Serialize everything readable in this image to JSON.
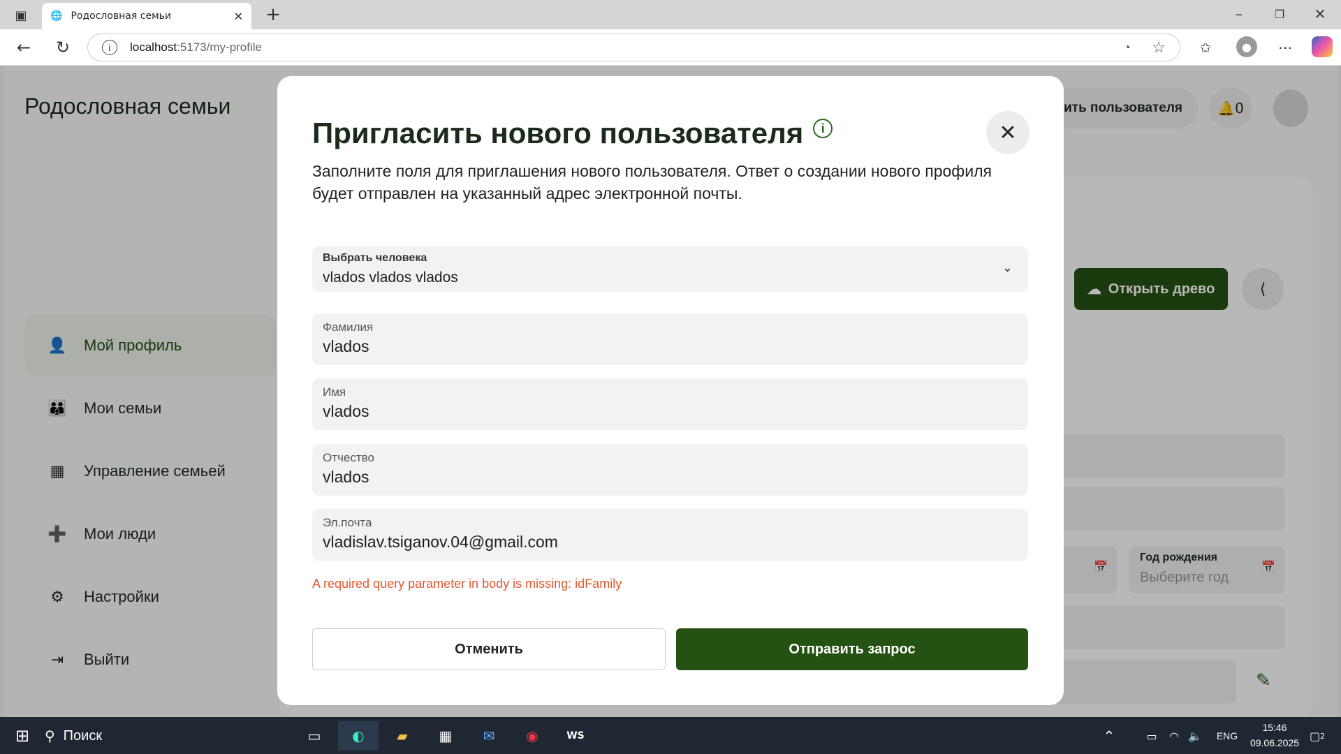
{
  "browser": {
    "tab_title": "Родословная семьи",
    "url_host": "localhost",
    "url_rest": ":5173/my-profile"
  },
  "app": {
    "title": "Родословная семьи",
    "header_invite_partial": "сить пользователя",
    "notif_count": "0",
    "open_tree": "Открыть древо",
    "birth_year_label": "Год рождения",
    "birth_year_placeholder": "Выберите год",
    "sidebar": [
      {
        "label": "Мой профиль"
      },
      {
        "label": "Мои семьи"
      },
      {
        "label": "Управление семьей"
      },
      {
        "label": "Мои люди"
      },
      {
        "label": "Настройки"
      },
      {
        "label": "Выйти"
      }
    ]
  },
  "modal": {
    "title": "Пригласить нового пользователя",
    "description": "Заполните поля для приглашения нового пользователя. Ответ о создании нового профиля будет отправлен на указанный адрес электронной почты.",
    "select_label": "Выбрать человека",
    "select_value": "vlados vlados vlados",
    "fields": [
      {
        "label": "Фамилия",
        "value": "vlados"
      },
      {
        "label": "Имя",
        "value": "vlados"
      },
      {
        "label": "Отчество",
        "value": "vlados"
      },
      {
        "label": "Эл.почта",
        "value": "vladislav.tsiganov.04@gmail.com"
      }
    ],
    "error": "A required query parameter in body is missing: idFamily",
    "cancel_label": "Отменить",
    "submit_label": "Отправить запрос"
  },
  "taskbar": {
    "search": "Поиск",
    "lang": "ENG",
    "time": "15:46",
    "date": "09.06.2025",
    "notif": "2"
  },
  "colors": {
    "accent": "#245212",
    "error": "#e4572e"
  }
}
